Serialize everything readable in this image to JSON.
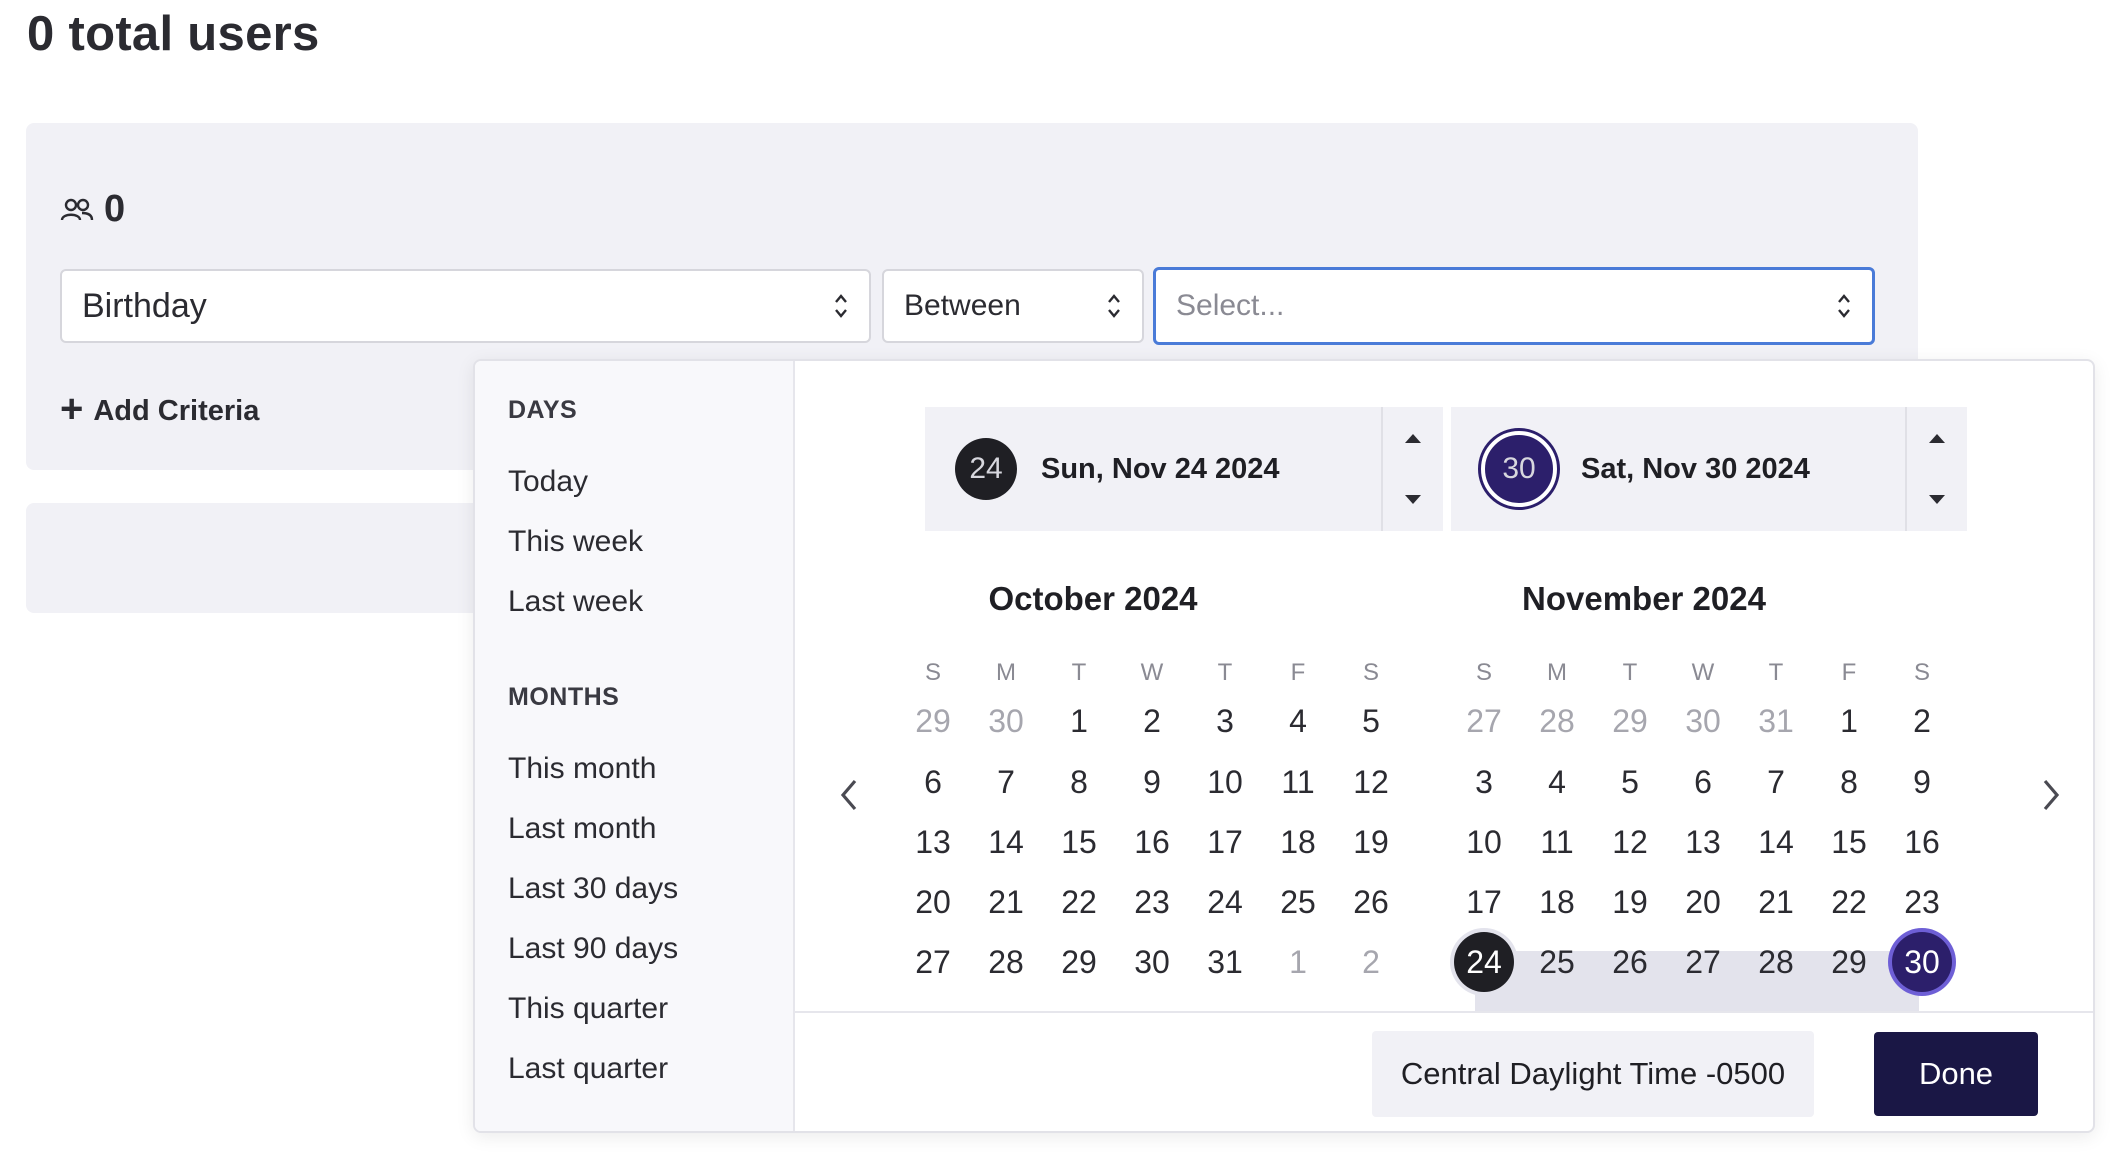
{
  "header": {
    "title": "0 total users"
  },
  "filter": {
    "user_count": "0",
    "field_value": "Birthday",
    "operator_value": "Between",
    "date_placeholder": "Select...",
    "add_criteria_label": "Add Criteria"
  },
  "picker": {
    "presets": {
      "days_heading": "DAYS",
      "days": [
        "Today",
        "This week",
        "Last week"
      ],
      "months_heading": "MONTHS",
      "months": [
        "This month",
        "Last month",
        "Last 30 days",
        "Last 90 days",
        "This quarter",
        "Last quarter"
      ]
    },
    "range_start": {
      "day": "24",
      "label": "Sun, Nov 24 2024"
    },
    "range_end": {
      "day": "30",
      "label": "Sat, Nov 30 2024"
    },
    "weekdays": [
      "S",
      "M",
      "T",
      "W",
      "T",
      "F",
      "S"
    ],
    "months": [
      {
        "title": "October 2024",
        "weeks": [
          [
            "29",
            "30",
            "1",
            "2",
            "3",
            "4",
            "5"
          ],
          [
            "6",
            "7",
            "8",
            "9",
            "10",
            "11",
            "12"
          ],
          [
            "13",
            "14",
            "15",
            "16",
            "17",
            "18",
            "19"
          ],
          [
            "20",
            "21",
            "22",
            "23",
            "24",
            "25",
            "26"
          ],
          [
            "27",
            "28",
            "29",
            "30",
            "31",
            "1",
            "2"
          ]
        ],
        "muted": [
          [
            0,
            0
          ],
          [
            0,
            1
          ],
          [
            4,
            5
          ],
          [
            4,
            6
          ]
        ]
      },
      {
        "title": "November 2024",
        "weeks": [
          [
            "27",
            "28",
            "29",
            "30",
            "31",
            "1",
            "2"
          ],
          [
            "3",
            "4",
            "5",
            "6",
            "7",
            "8",
            "9"
          ],
          [
            "10",
            "11",
            "12",
            "13",
            "14",
            "15",
            "16"
          ],
          [
            "17",
            "18",
            "19",
            "20",
            "21",
            "22",
            "23"
          ],
          [
            "24",
            "25",
            "26",
            "27",
            "28",
            "29",
            "30"
          ]
        ],
        "muted": [
          [
            0,
            0
          ],
          [
            0,
            1
          ],
          [
            0,
            2
          ],
          [
            0,
            3
          ],
          [
            0,
            4
          ]
        ]
      }
    ],
    "timezone": "Central Daylight Time -0500",
    "done_label": "Done",
    "colors": {
      "selected_start": "#1f1f24",
      "selected_end": "#2c1f6b",
      "range_fill": "#e3e3ec",
      "done_bg": "#1a1745"
    }
  }
}
